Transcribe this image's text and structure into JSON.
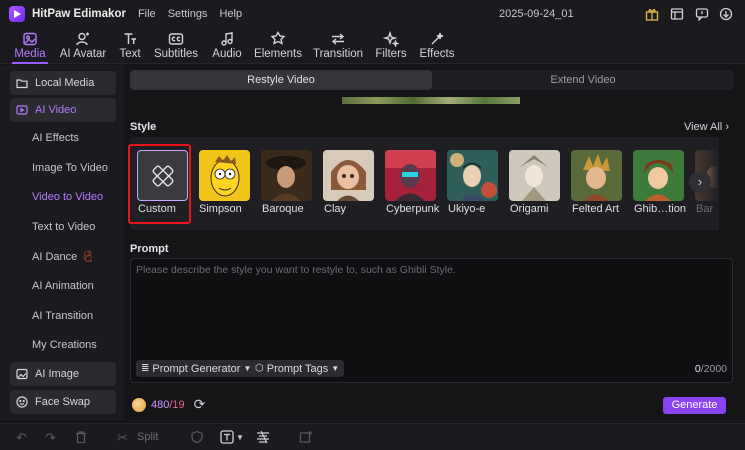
{
  "app": {
    "name": "HitPaw Edimakor",
    "project": "2025-09-24_01"
  },
  "menu": [
    "File",
    "Settings",
    "Help"
  ],
  "title_icons": [
    "gift-icon",
    "layout-icon",
    "message-icon",
    "download-icon"
  ],
  "toolbar": {
    "items": [
      {
        "label": "Media",
        "icon": "media-icon",
        "active": true
      },
      {
        "label": "AI Avatar",
        "icon": "avatar-icon"
      },
      {
        "label": "Text",
        "icon": "text-icon"
      },
      {
        "label": "Subtitles",
        "icon": "subtitles-icon"
      },
      {
        "label": "Audio",
        "icon": "audio-icon"
      },
      {
        "label": "Elements",
        "icon": "elements-icon"
      },
      {
        "label": "Transition",
        "icon": "transition-icon"
      },
      {
        "label": "Filters",
        "icon": "filters-icon"
      },
      {
        "label": "Effects",
        "icon": "effects-icon"
      }
    ]
  },
  "sidebar": {
    "local_media": "Local Media",
    "ai_video": "AI Video",
    "sub": [
      "AI Effects",
      "Image To Video",
      "Video to Video",
      "Text to Video",
      "AI Dance",
      "AI Animation",
      "AI Transition",
      "My Creations"
    ],
    "ai_image": "AI Image",
    "face_swap": "Face Swap"
  },
  "tabs": [
    "Restyle Video",
    "Extend Video"
  ],
  "style": {
    "title": "Style",
    "view_all": "View All",
    "cards": [
      {
        "label": "Custom",
        "color": "#3a3a40"
      },
      {
        "label": "Simpson",
        "color": "#f2c81c"
      },
      {
        "label": "Baroque",
        "color": "#6e4a2c"
      },
      {
        "label": "Clay",
        "color": "#c9a58a"
      },
      {
        "label": "Cyberpunk",
        "color": "#b8263a"
      },
      {
        "label": "Ukiyo-e",
        "color": "#3f6f6a"
      },
      {
        "label": "Origami",
        "color": "#d9d2c6"
      },
      {
        "label": "Felted Art",
        "color": "#7a6a3c"
      },
      {
        "label": "Ghib…tion",
        "color": "#3e7a3c"
      },
      {
        "label": "Bar",
        "color": "#5a4a3a"
      }
    ]
  },
  "prompt": {
    "title": "Prompt",
    "placeholder": "Please describe the style you want to restyle to, such as Ghibli Style.",
    "generator": "Prompt Generator",
    "tags": "Prompt Tags",
    "count": "0",
    "max": "/2000"
  },
  "credits": {
    "available": "480",
    "cost": "/19"
  },
  "generate": "Generate",
  "bottom": {
    "split": "Split"
  }
}
